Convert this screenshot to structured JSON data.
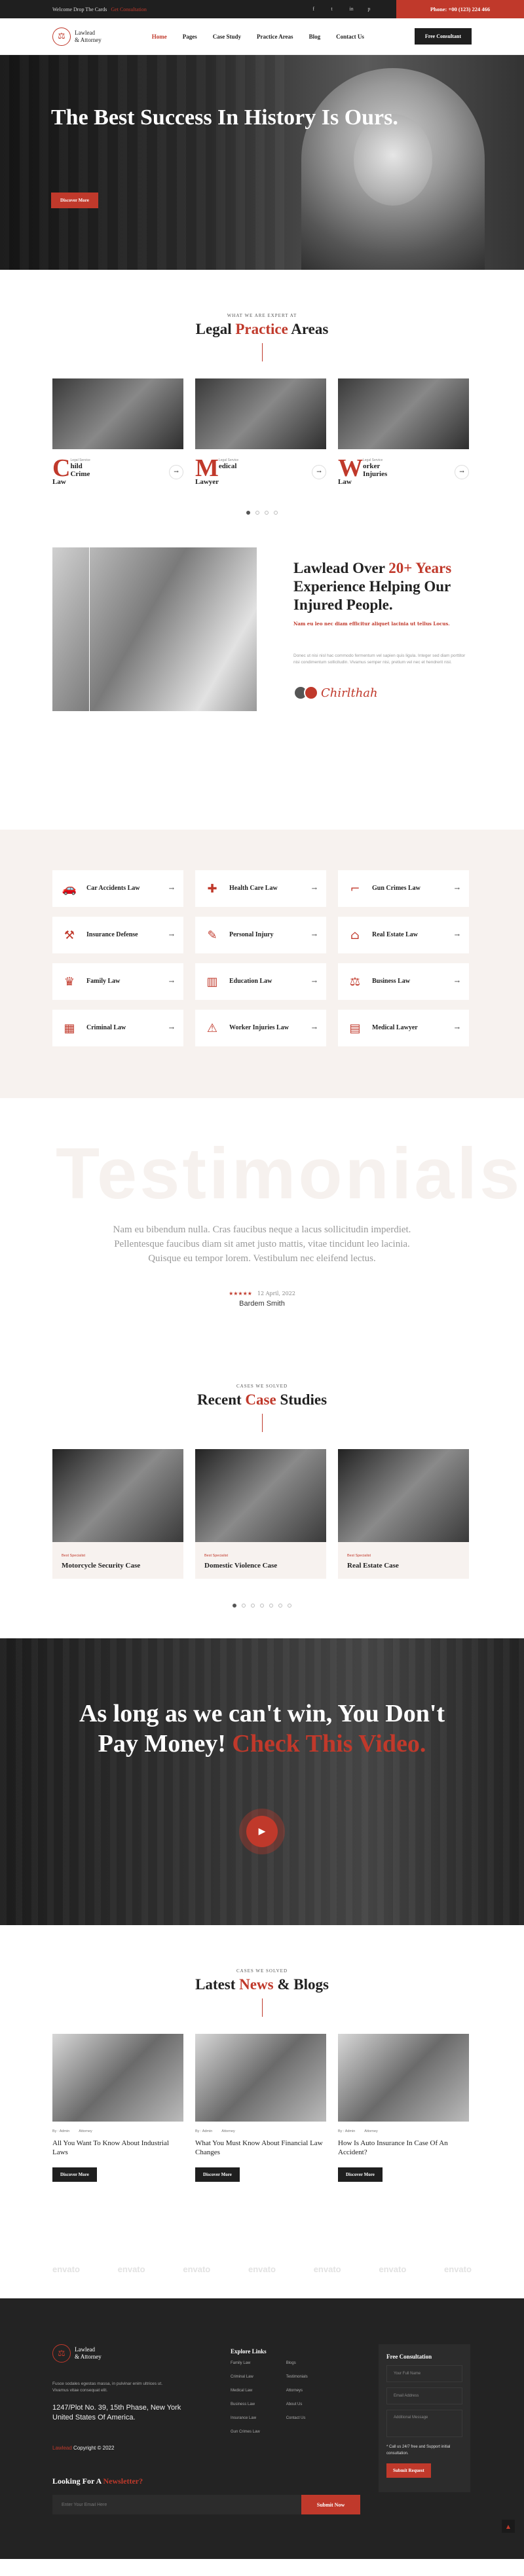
{
  "topbar": {
    "welcome": "Welcome Drop The Cards",
    "welcome_link": "Get Consultation",
    "phone": "Phone: +00 (123) 224 466",
    "socials": [
      "f",
      "t",
      "in",
      "p"
    ]
  },
  "nav": {
    "brand_line1": "Lawlead",
    "brand_line2": "& Attorney",
    "items": [
      "Home",
      "Pages",
      "Case Study",
      "Practice Areas",
      "Blog",
      "Contact Us"
    ],
    "cta": "Free Consultant"
  },
  "hero": {
    "title": "The Best Success In History Is Ours.",
    "button": "Discover More"
  },
  "practice": {
    "kicker": "WHAT WE ARE EXPERT AT",
    "title_pre": "Legal ",
    "title_accent": "Practice",
    "title_post": " Areas",
    "cards": [
      {
        "letter": "C",
        "category": "Legal Service",
        "name": "hild Crime Law"
      },
      {
        "letter": "M",
        "category": "Legal Service",
        "name": "edical Lawyer"
      },
      {
        "letter": "W",
        "category": "Legal Service",
        "name": "orker Injuries Law"
      }
    ]
  },
  "about": {
    "title_pre": "Lawlead Over ",
    "title_accent": "20+ Years",
    "title_post": " Experience Helping Our Injured People.",
    "subtitle": "Nam eu leo nec diam efficitur aliquet lacinia ut tellus Locus.",
    "body": "Donec ut nisi nisl hac commodo fermentum vel sapien quis ligula. Integer sed diam porttitor nisi condimentum sollicitudin. Vivamus semper nisi, pretium vel nec et hendrerit nisl.",
    "signature": "Chirlthah"
  },
  "areas": {
    "items": [
      {
        "name": "Car Accidents Law",
        "icon": "car-icon",
        "glyph": "🚗"
      },
      {
        "name": "Health Care Law",
        "icon": "health-icon",
        "glyph": "✚"
      },
      {
        "name": "Gun Crimes Law",
        "icon": "gun-icon",
        "glyph": "⌐"
      },
      {
        "name": "Insurance Defense",
        "icon": "gavel-icon",
        "glyph": "⚒"
      },
      {
        "name": "Personal Injury",
        "icon": "injury-icon",
        "glyph": "✎"
      },
      {
        "name": "Real Estate Law",
        "icon": "estate-icon",
        "glyph": "⌂"
      },
      {
        "name": "Family Law",
        "icon": "family-icon",
        "glyph": "♛"
      },
      {
        "name": "Education Law",
        "icon": "education-icon",
        "glyph": "▥"
      },
      {
        "name": "Business Law",
        "icon": "business-icon",
        "glyph": "⚖"
      },
      {
        "name": "Criminal Law",
        "icon": "criminal-icon",
        "glyph": "▦"
      },
      {
        "name": "Worker Injuries Law",
        "icon": "worker-icon",
        "glyph": "⚠"
      },
      {
        "name": "Medical Lawyer",
        "icon": "medical-icon",
        "glyph": "▤"
      }
    ]
  },
  "testimonials": {
    "ghost": "Testimonials",
    "quote": "Nam eu bibendum nulla. Cras faucibus neque a lacus sollicitudin imperdiet. Pellentesque faucibus diam sit amet justo mattis, vitae tincidunt leo lacinia. Quisque eu tempor lorem. Vestibulum nec eleifend lectus.",
    "stars": "★★★★★",
    "date": "12 April, 2022",
    "author": "Bardem Smith"
  },
  "cases": {
    "kicker": "CASES WE SOLVED",
    "title_pre": "Recent ",
    "title_accent": "Case",
    "title_post": " Studies",
    "cards": [
      {
        "category": "Best Specialist",
        "name": "Motorcycle Security Case"
      },
      {
        "category": "Best Specialist",
        "name": "Domestic Violence Case"
      },
      {
        "category": "Best Specialist",
        "name": "Real Estate Case"
      }
    ]
  },
  "video": {
    "title_pre": "As long as we can't win, You Don't Pay Money! ",
    "title_accent": "Check This Video."
  },
  "blogs": {
    "kicker": "CASES WE SOLVED",
    "title_pre": "Latest ",
    "title_accent": "News",
    "title_post": " & Blogs",
    "cards": [
      {
        "author": "By : Admin",
        "category": "Attorney",
        "title": "All You Want To Know About Industrial Laws",
        "button": "Discover More"
      },
      {
        "author": "By : Admin",
        "category": "Attorney",
        "title": "What You Must Know About Financial Law Changes",
        "button": "Discover More"
      },
      {
        "author": "By : Admin",
        "category": "Attorney",
        "title": "How Is Auto Insurance In Case Of An Accident?",
        "button": "Discover More"
      }
    ]
  },
  "brands": [
    "envato",
    "envato",
    "envato",
    "envato",
    "envato",
    "envato",
    "envato"
  ],
  "footer": {
    "about": "Fusce sodales egestas massa, in pulvinar enim ultrices ut. Vivamus vitae consequat elit.",
    "address": "1247/Plot No. 39, 15th Phase, New York United States Of America.",
    "copy_brand": "Lawlead",
    "copy_text": " Copyright © 2022",
    "news_pre": "Looking For A ",
    "news_accent": "Newsletter?",
    "news_placeholder": "Enter Your Email Here",
    "news_button": "Submit Now",
    "explore_title": "Explore Links",
    "links_col1": [
      "Family Law",
      "Criminal Law",
      "Medical Law",
      "Business Law",
      "Insurance Law",
      "Gun Crimes Law"
    ],
    "links_col2": [
      "Blogs",
      "Testimonials",
      "Attorneys",
      "About Us",
      "Contact Us"
    ],
    "consult_title": "Free Consultation",
    "consult_name": "Your Full Name",
    "consult_email": "Email Address",
    "consult_msg": "Additional Message",
    "consult_call": "* Call us 24/7 free and Support initial consultation.",
    "consult_button": "Submit Request",
    "to_top": "▲"
  }
}
